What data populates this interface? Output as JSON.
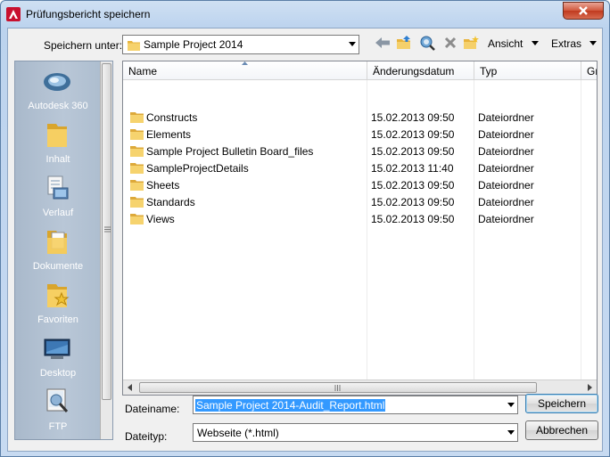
{
  "window": {
    "title": "Prüfungsbericht speichern"
  },
  "toolbar": {
    "save_in_label": "Speichern unter:",
    "location_value": "Sample Project 2014",
    "view_menu_label": "Ansicht",
    "tools_menu_label": "Extras"
  },
  "places": [
    {
      "label": "Autodesk 360",
      "icon": "cloud-icon"
    },
    {
      "label": "Inhalt",
      "icon": "folder-icon"
    },
    {
      "label": "Verlauf",
      "icon": "history-icon"
    },
    {
      "label": "Dokumente",
      "icon": "documents-icon"
    },
    {
      "label": "Favoriten",
      "icon": "favorites-icon"
    },
    {
      "label": "Desktop",
      "icon": "desktop-icon"
    },
    {
      "label": "FTP",
      "icon": "ftp-icon"
    }
  ],
  "filelist": {
    "columns": [
      "Name",
      "Änderungsdatum",
      "Typ",
      "Grö"
    ],
    "rows": [
      {
        "name": "Constructs",
        "date": "15.02.2013 09:50",
        "type": "Dateiordner"
      },
      {
        "name": "Elements",
        "date": "15.02.2013 09:50",
        "type": "Dateiordner"
      },
      {
        "name": "Sample Project Bulletin Board_files",
        "date": "15.02.2013 09:50",
        "type": "Dateiordner"
      },
      {
        "name": "SampleProjectDetails",
        "date": "15.02.2013 11:40",
        "type": "Dateiordner"
      },
      {
        "name": "Sheets",
        "date": "15.02.2013 09:50",
        "type": "Dateiordner"
      },
      {
        "name": "Standards",
        "date": "15.02.2013 09:50",
        "type": "Dateiordner"
      },
      {
        "name": "Views",
        "date": "15.02.2013 09:50",
        "type": "Dateiordner"
      }
    ]
  },
  "form": {
    "filename_label": "Dateiname:",
    "filename_value": "Sample Project 2014-Audit_Report.html",
    "filetype_label": "Dateityp:",
    "filetype_value": "Webseite (*.html)",
    "save_button": "Speichern",
    "cancel_button": "Abbrechen"
  },
  "colors": {
    "accent": "#3399ff",
    "places_bg": "#b9c7d7",
    "folder": "#f2c24f"
  }
}
